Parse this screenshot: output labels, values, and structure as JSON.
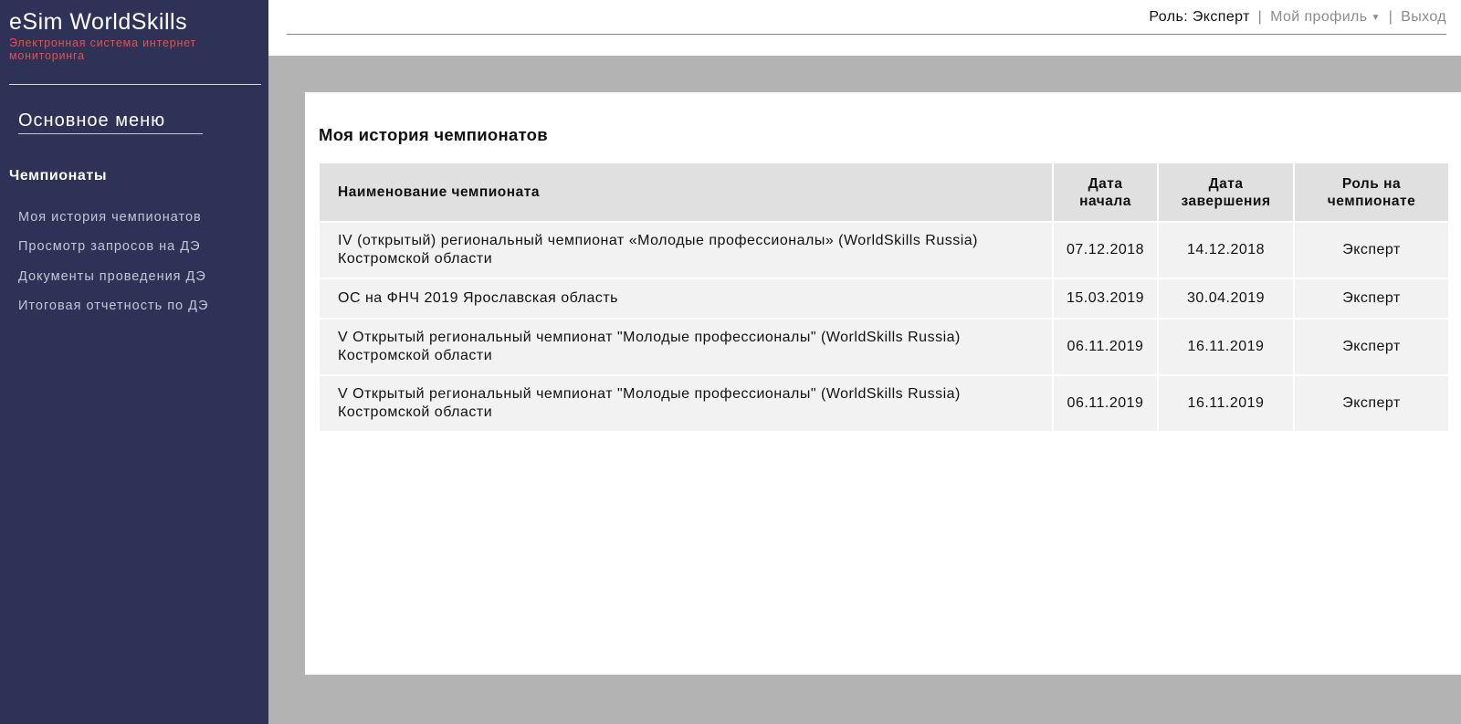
{
  "brand": {
    "title": "eSim WorldSkills",
    "subtitle": "Электронная система интернет мониторинга"
  },
  "sidebar": {
    "menu_heading": "Основное меню",
    "section_title": "Чемпионаты",
    "items": [
      {
        "label": "Моя история чемпионатов"
      },
      {
        "label": "Просмотр запросов на ДЭ"
      },
      {
        "label": "Документы проведения ДЭ"
      },
      {
        "label": "Итоговая отчетность по ДЭ"
      }
    ]
  },
  "header": {
    "role_label": "Роль: Эксперт",
    "separator": "|",
    "profile_label": "Мой профиль",
    "profile_caret": "▼",
    "logout_label": "Выход"
  },
  "main": {
    "title": "Моя история чемпионатов",
    "table": {
      "columns": [
        "Наименование чемпионата",
        "Дата начала",
        "Дата завершения",
        "Роль на чемпионате"
      ],
      "rows": [
        {
          "name": "IV (открытый) региональный чемпионат «Молодые профессионалы» (WorldSkills Russia) Костромской области",
          "start": "07.12.2018",
          "end": "14.12.2018",
          "role": "Эксперт"
        },
        {
          "name": "ОС на ФНЧ 2019 Ярославская область",
          "start": "15.03.2019",
          "end": "30.04.2019",
          "role": "Эксперт"
        },
        {
          "name": "V Открытый региональный чемпионат \"Молодые профессионалы\" (WorldSkills Russia) Костромской области",
          "start": "06.11.2019",
          "end": "16.11.2019",
          "role": "Эксперт"
        },
        {
          "name": "V Открытый региональный чемпионат \"Молодые профессионалы\" (WorldSkills Russia) Костромской области",
          "start": "06.11.2019",
          "end": "16.11.2019",
          "role": "Эксперт"
        }
      ]
    }
  },
  "colors": {
    "sidebar_bg": "#2e3256",
    "subtitle_accent": "#e0534f",
    "page_bg": "#b3b3b3"
  }
}
